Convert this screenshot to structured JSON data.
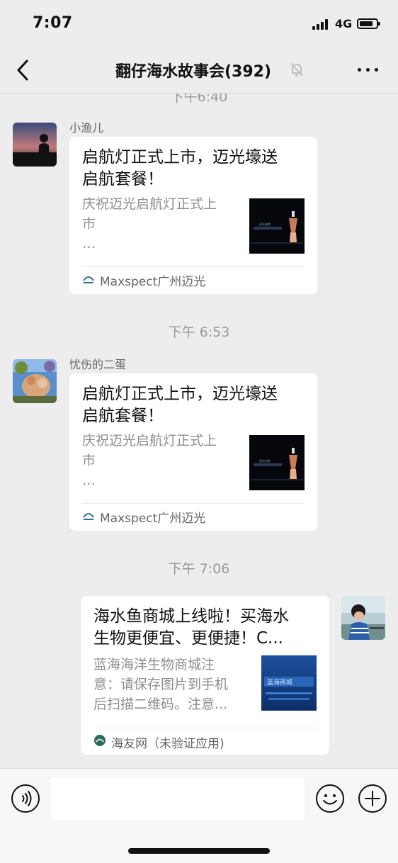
{
  "status_bar": {
    "time": "7:07",
    "network": "4G"
  },
  "nav": {
    "title": "翻仔海水故事会(392)"
  },
  "chat": {
    "partial_time": "下午6:40",
    "messages": [
      {
        "sender": "小渔儿",
        "title_line1": "启航灯正式上市，迈光壕送",
        "title_line2": "启航套餐！",
        "desc_line1": "庆祝迈光启航灯正式上",
        "desc_line2": "市",
        "desc_line3": "…",
        "source": "Maxspect广州迈光"
      },
      {
        "time": "下午 6:53",
        "sender": "忧伤的二蛋",
        "title_line1": "启航灯正式上市，迈光壕送",
        "title_line2": "启航套餐！",
        "desc_line1": "庆祝迈光启航灯正式上",
        "desc_line2": "市",
        "desc_line3": "…",
        "source": "Maxspect广州迈光"
      },
      {
        "time": "下午 7:06",
        "title_line1": "海水鱼商城上线啦！买海水",
        "title_line2": "生物更便宜、更便捷！C...",
        "desc_line1": "蓝海海洋生物商城注",
        "desc_line2": "意：请保存图片到手机",
        "desc_line3": "后扫描二维码。注意...",
        "source": "海友网（未验证应用)"
      }
    ]
  },
  "input_bar": {
    "placeholder": ""
  },
  "colors": {
    "background": "#ededed",
    "bubble": "#ffffff",
    "muted_text": "#9a9a9a",
    "source_green": "#2e6b5e"
  }
}
